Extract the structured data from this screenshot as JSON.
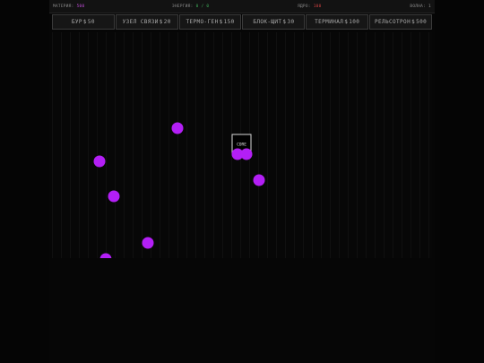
{
  "status": {
    "matter_label": "МАТЕРИЯ:",
    "matter_value": "500",
    "energy_label": "ЭНЕРГИЯ:",
    "energy_value": "0 / 0",
    "core_label": "ЯДРО:",
    "core_value": "100",
    "wave_label": "ВОЛНА:",
    "wave_value": "1"
  },
  "build_menu": [
    {
      "name": "БУР",
      "cost": "50"
    },
    {
      "name": "УЗЕЛ СВЯЗИ",
      "cost": "20"
    },
    {
      "name": "ТЕРМО-ГЕН",
      "cost": "150"
    },
    {
      "name": "БЛОК-ЩИТ",
      "cost": "30"
    },
    {
      "name": "ТЕРМИНАЛ",
      "cost": "100"
    },
    {
      "name": "РЕЛЬСОТРОН",
      "cost": "500"
    }
  ],
  "core": {
    "label": "CORE"
  },
  "colors": {
    "matter": "#c04dd8",
    "energy": "#3fae5a",
    "core_value": "#d04040",
    "enemy": "#b31ff5"
  },
  "enemy_count": 8
}
